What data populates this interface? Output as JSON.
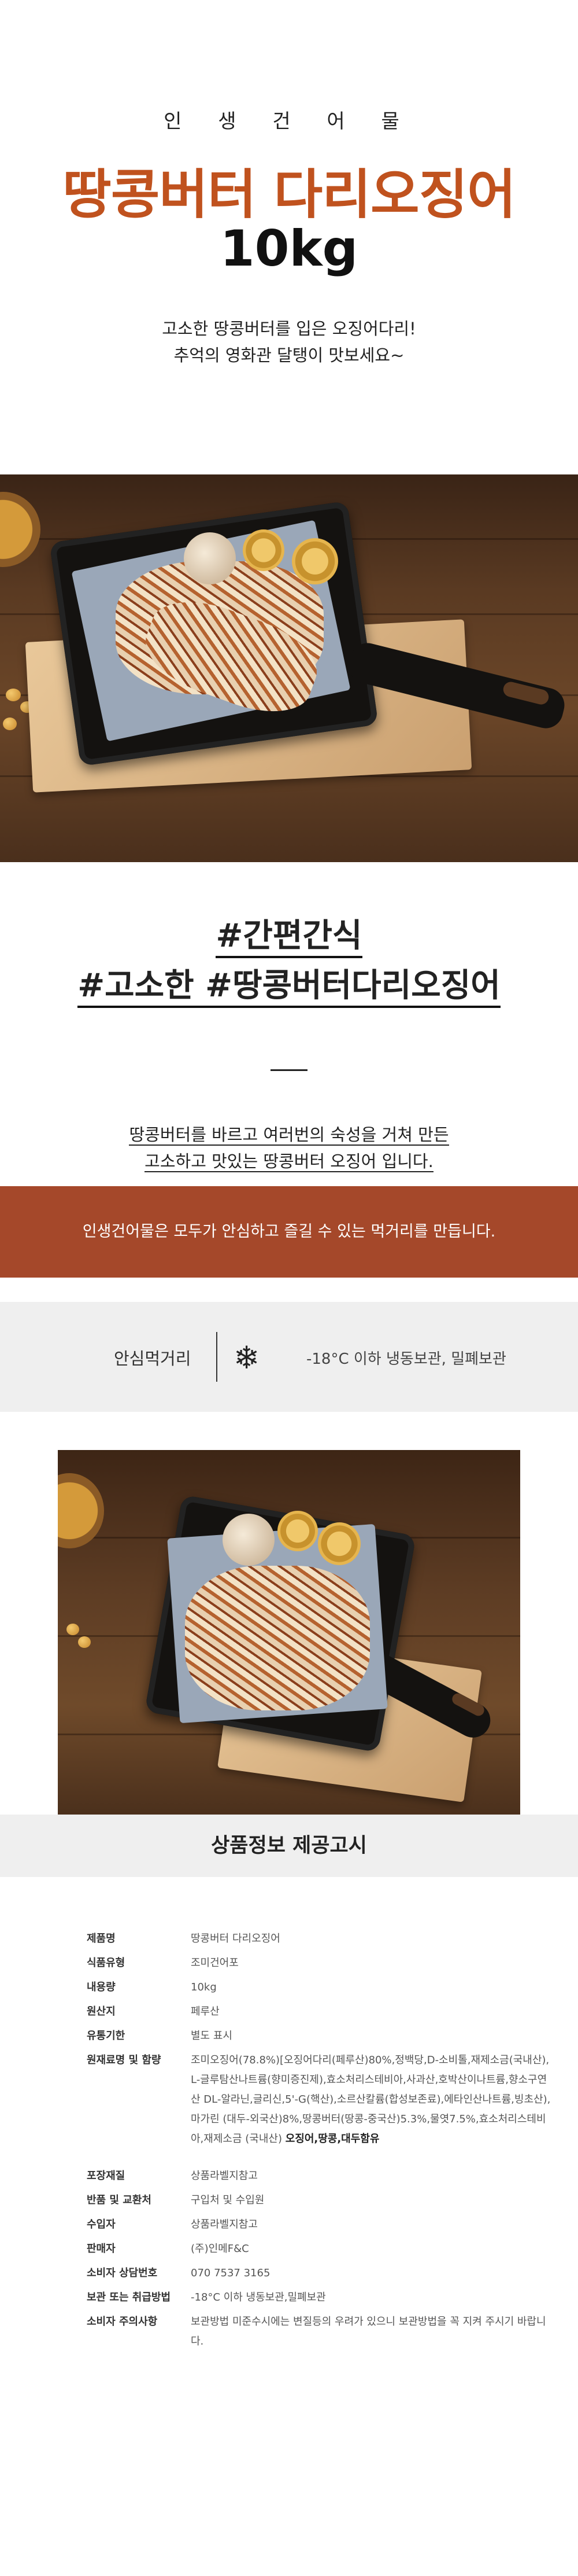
{
  "header": {
    "brand": "인 생 건 어 물",
    "title": "땅콩버터 다리오징어",
    "weight": "10kg",
    "description_lines": [
      "고소한 땅콩버터를 입은 오징어다리!",
      "추억의 영화관 달탱이 맛보세요~"
    ]
  },
  "tags": {
    "line1": "#간편간식",
    "line2": "#고소한 #땅콩버터다리오징어",
    "desc_lines": [
      "땅콩버터를 바르고 여러번의 숙성을 거쳐 만든",
      "고소하고 맛있는 땅콩버터 오징어 입니다."
    ]
  },
  "banner": {
    "text": "인생건어물은 모두가 안심하고 즐길 수 있는 먹거리를 만듭니다."
  },
  "storage": {
    "label": "안심먹거리",
    "icon": "snowflake-icon",
    "text": "-18°C 이하 냉동보관, 밀폐보관"
  },
  "info": {
    "heading": "상품정보 제공고시",
    "rows": [
      {
        "key": "제품명",
        "value": "땅콩버터 다리오징어"
      },
      {
        "key": "식품유형",
        "value": "조미건어포"
      },
      {
        "key": "내용량",
        "value": "10kg"
      },
      {
        "key": "원산지",
        "value": "페루산"
      },
      {
        "key": "유통기한",
        "value": "별도 표시"
      },
      {
        "key": "원재료명 및 함량",
        "value": "조미오징어(78.8%)[오징어다리(페루산)80%,정백당,D-소비톨,재제소금(국내산), L-글루탐산나트륨(향미증진제),효소처리스테비아,사과산,호박산이나트륨,향소구연산 DL-알라닌,글리신,5'-G(핵산),소르산칼륨(합성보존료),에타인산나트륨,빙초산),마가린 (대두-외국산)8%,땅콩버터(땅콩-중국산)5.3%,물엿7.5%,효소처리스테비아,재제소금 (국내산)",
        "allergy": "오징어,땅콩,대두함유"
      },
      {
        "key": "포장재질",
        "value": "상품라벨지참고"
      },
      {
        "key": "반품 및 교환처",
        "value": "구입처 및 수입원"
      },
      {
        "key": "수입자",
        "value": "상품라벨지참고"
      },
      {
        "key": "판매자",
        "value": "(주)인메F&C"
      },
      {
        "key": "소비자 상담번호",
        "value": "070 7537 3165"
      },
      {
        "key": "보관 또는 취급방법",
        "value": "-18°C 이하 냉동보관,밀폐보관"
      },
      {
        "key": "소비자 주의사항",
        "value": "보관방법 미준수시에는 변질등의 우려가 있으니 보관방법을 꼭 지켜 주시기 바랍니다."
      }
    ]
  }
}
